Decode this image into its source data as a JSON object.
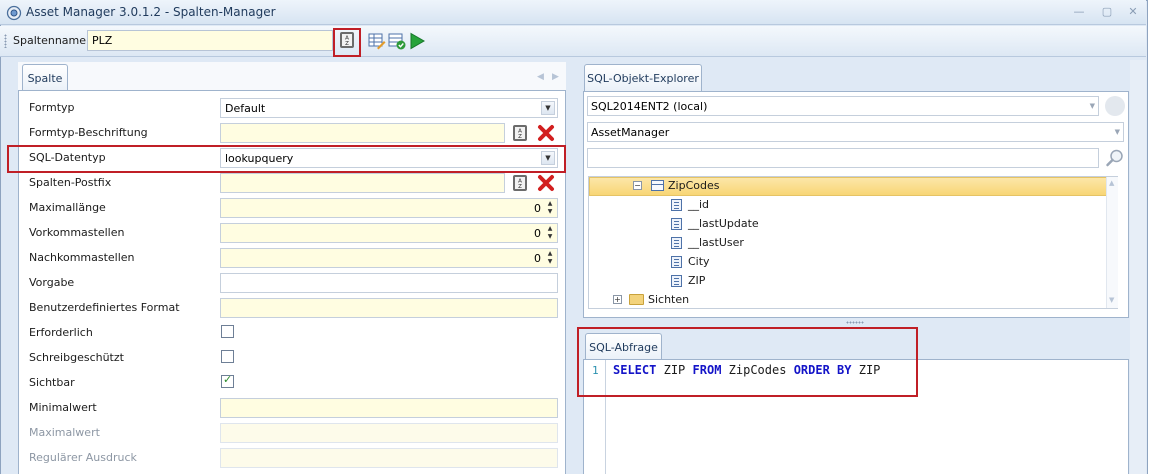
{
  "window": {
    "title": "Asset Manager 3.0.1.2 - Spalten-Manager"
  },
  "toolbar": {
    "column_name_label": "Spaltenname:",
    "column_name_value": "PLZ",
    "buttons": [
      "az-sort-icon",
      "grid-edit-icon",
      "grid-check-icon",
      "play-icon"
    ]
  },
  "left_panel": {
    "tab": "Spalte",
    "properties": [
      {
        "label": "Formtyp",
        "value": "Default"
      },
      {
        "label": "Formtyp-Beschriftung",
        "value": ""
      },
      {
        "label": "SQL-Datentyp",
        "value": "lookupquery"
      },
      {
        "label": "Spalten-Postfix",
        "value": ""
      },
      {
        "label": "Maximallänge",
        "value": "0"
      },
      {
        "label": "Vorkommastellen",
        "value": "0"
      },
      {
        "label": "Nachkommastellen",
        "value": "0"
      },
      {
        "label": "Vorgabe",
        "value": ""
      },
      {
        "label": "Benutzerdefiniertes Format",
        "value": ""
      },
      {
        "label": "Erforderlich",
        "checked": false
      },
      {
        "label": "Schreibgeschützt",
        "checked": false
      },
      {
        "label": "Sichtbar",
        "checked": true
      },
      {
        "label": "Minimalwert",
        "value": ""
      },
      {
        "label": "Maximalwert",
        "value": ""
      },
      {
        "label": "Regulärer Ausdruck",
        "value": ""
      }
    ]
  },
  "explorer": {
    "tab": "SQL-Objekt-Explorer",
    "server": "SQL2014ENT2 (local)",
    "database": "AssetManager",
    "filter": "",
    "tree": {
      "table": "ZipCodes",
      "columns": [
        "__id",
        "__lastUpdate",
        "__lastUser",
        "City",
        "ZIP"
      ],
      "views_folder": "Sichten"
    }
  },
  "sql_query": {
    "tab": "SQL-Abfrage",
    "line_number": "1",
    "tokens": [
      "SELECT",
      "ZIP",
      "FROM",
      "ZipCodes",
      "ORDER BY",
      "ZIP"
    ]
  },
  "colors": {
    "highlight_red": "#c01f26",
    "input_yellow": "#fffde1",
    "sql_keyword": "#1414c8",
    "selection": "#f8d675"
  }
}
